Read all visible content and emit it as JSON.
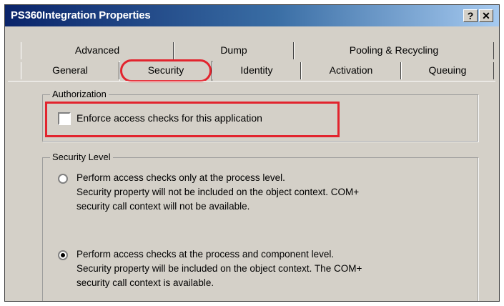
{
  "window": {
    "title": "PS360Integration Properties",
    "help_label": "?",
    "close_label": "✕"
  },
  "tabs": {
    "back_row": [
      "Advanced",
      "Dump",
      "Pooling & Recycling"
    ],
    "front_row": [
      "General",
      "Security",
      "Identity",
      "Activation",
      "Queuing"
    ],
    "active": "Security"
  },
  "authorization": {
    "legend": "Authorization",
    "checkbox_label": "Enforce access checks for this application",
    "checked": false
  },
  "security_level": {
    "legend": "Security Level",
    "options": [
      {
        "selected": false,
        "line1": "Perform access checks only at the process level.",
        "line2": "Security property will not be included on the object context. COM+",
        "line3": "security call context will not be available."
      },
      {
        "selected": true,
        "line1": "Perform access checks at the process and component level.",
        "line2": "Security property will be included on the object context. The COM+",
        "line3": "security call context is available."
      }
    ]
  },
  "colors": {
    "highlight": "#e2242e",
    "titlebar": "#0a246a",
    "face": "#d4d0c8"
  }
}
